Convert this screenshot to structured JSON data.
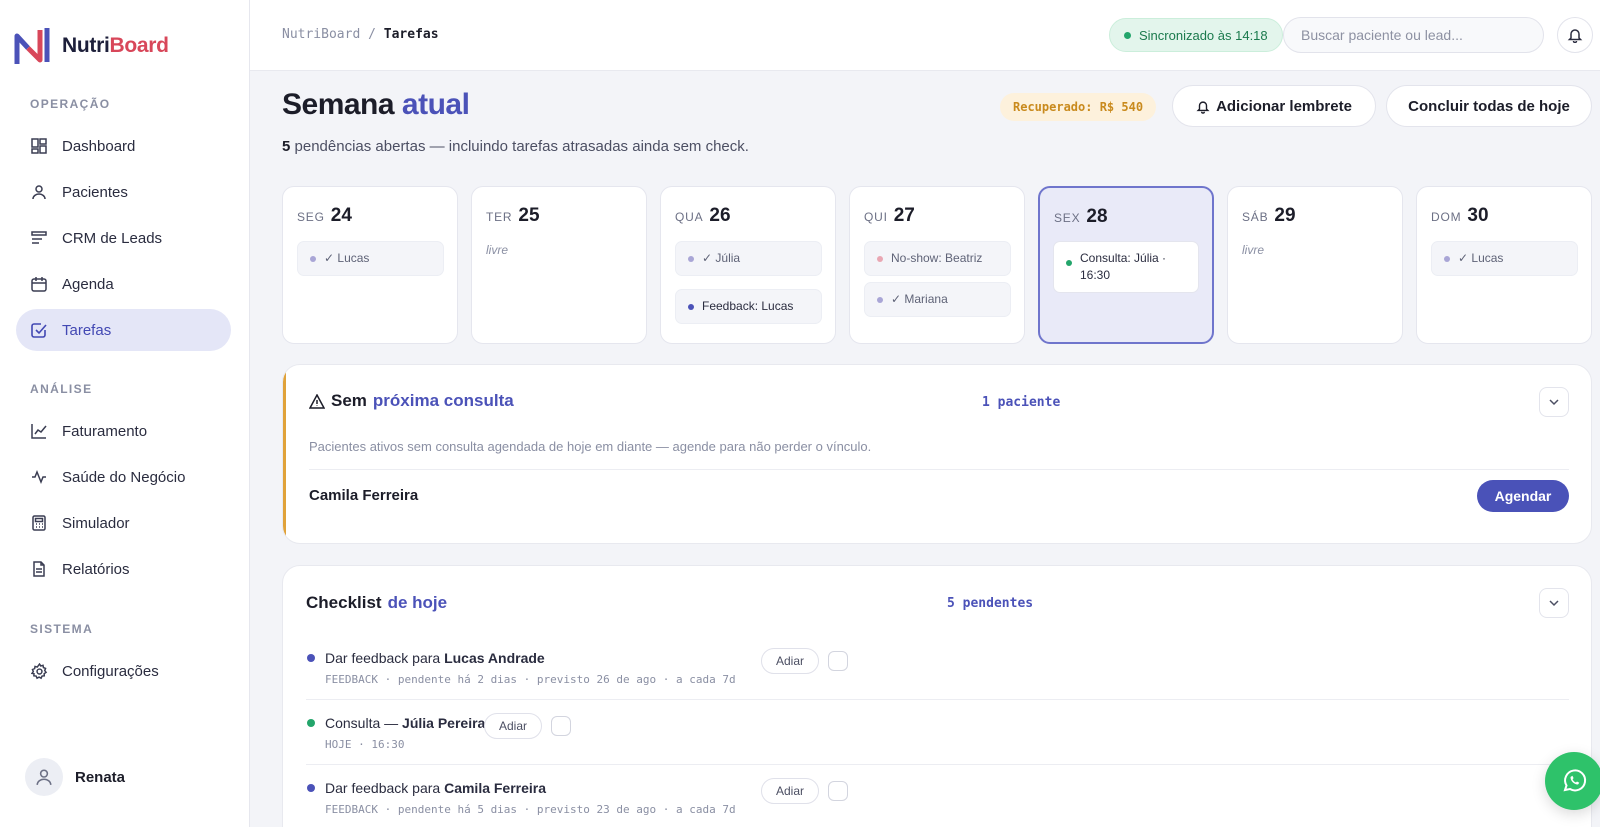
{
  "brand": {
    "name_a": "Nutri",
    "name_b": "Board"
  },
  "sidebar": {
    "sections": [
      "OPERAÇÃO",
      "ANÁLISE",
      "SISTEMA"
    ],
    "items": [
      {
        "label": "Dashboard"
      },
      {
        "label": "Pacientes"
      },
      {
        "label": "CRM de Leads"
      },
      {
        "label": "Agenda"
      },
      {
        "label": "Tarefas"
      },
      {
        "label": "Faturamento"
      },
      {
        "label": "Saúde do Negócio"
      },
      {
        "label": "Simulador"
      },
      {
        "label": "Relatórios"
      },
      {
        "label": "Configurações"
      }
    ],
    "user": "Renata"
  },
  "topbar": {
    "breadcrumb_root": "NutriBoard",
    "breadcrumb_sep": "/",
    "breadcrumb_current": "Tarefas",
    "sync": "Sincronizado às 14:18",
    "search_placeholder": "Buscar paciente ou lead..."
  },
  "header": {
    "title_a": "Semana",
    "title_b": "atual",
    "subtitle_count": "5",
    "subtitle_text": "pendências abertas — incluindo tarefas atrasadas ainda sem check.",
    "recovered": "Recuperado: R$ 540",
    "add_reminder": "Adicionar lembrete",
    "complete_all": "Concluir todas de hoje"
  },
  "week": [
    {
      "abbr": "SEG",
      "num": "24",
      "free": "",
      "chips": [
        "✓ Lucas"
      ]
    },
    {
      "abbr": "TER",
      "num": "25",
      "free": "livre",
      "chips": []
    },
    {
      "abbr": "QUA",
      "num": "26",
      "free": "",
      "chips": [
        "✓ Júlia",
        "Feedback: Lucas"
      ]
    },
    {
      "abbr": "QUI",
      "num": "27",
      "free": "",
      "chips": [
        "No-show: Beatriz",
        "✓ Mariana"
      ]
    },
    {
      "abbr": "SEX",
      "num": "28",
      "free": "",
      "chips": [
        "Consulta: Júlia · 16:30"
      ]
    },
    {
      "abbr": "SÁB",
      "num": "29",
      "free": "livre",
      "chips": []
    },
    {
      "abbr": "DOM",
      "num": "30",
      "free": "",
      "chips": [
        "✓ Lucas"
      ]
    }
  ],
  "no_next": {
    "title_a": "Sem",
    "title_b": "próxima consulta",
    "count": "1 paciente",
    "description": "Pacientes ativos sem consulta agendada de hoje em diante — agende para não perder o vínculo.",
    "patient": "Camila Ferreira",
    "schedule": "Agendar"
  },
  "checklist": {
    "title_a": "Checklist",
    "title_b": "de hoje",
    "count": "5 pendentes",
    "postpone": "Adiar",
    "tasks": [
      {
        "prefix": "Dar feedback para",
        "name": "Lucas Andrade",
        "meta": "FEEDBACK · pendente há 2 dias · previsto 26 de ago · a cada 7d"
      },
      {
        "prefix": "Consulta —",
        "name": "Júlia Pereira",
        "meta": "HOJE · 16:30"
      },
      {
        "prefix": "Dar feedback para",
        "name": "Camila Ferreira",
        "meta": "FEEDBACK · pendente há 5 dias · previsto 23 de ago · a cada 7d"
      }
    ]
  },
  "colors": {
    "accent": "#4b52b8",
    "brand_red": "#d8475a",
    "success": "#23a56b",
    "warning": "#e0a23a"
  }
}
